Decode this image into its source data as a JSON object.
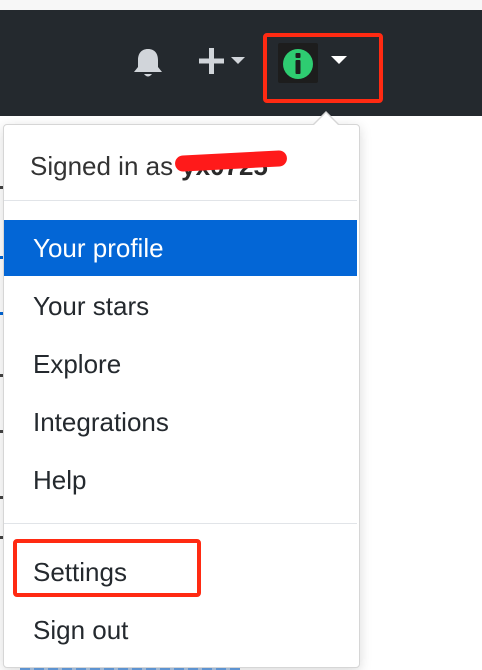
{
  "header": {
    "icons": {
      "notifications": "bell-icon",
      "create_new": "plus-icon",
      "create_caret": "caret-down-icon",
      "avatar": "avatar-identicon",
      "avatar_caret": "caret-down-icon"
    },
    "avatar_letter": "i",
    "colors": {
      "header_bg": "#24292e",
      "icon": "#d1d5da",
      "avatar_green": "#2ecc71"
    }
  },
  "dropdown": {
    "signed_in_prefix": "Signed in as",
    "username": "yx0725",
    "items": [
      {
        "label": "Your profile",
        "active": true
      },
      {
        "label": "Your stars"
      },
      {
        "label": "Explore"
      },
      {
        "label": "Integrations"
      },
      {
        "label": "Help"
      },
      {
        "label": "Settings"
      },
      {
        "label": "Sign out"
      }
    ]
  },
  "annotations": {
    "highlight_color": "#ff2a12",
    "redaction_color": "#ff1a1a"
  },
  "colors": {
    "active_item_bg": "#0366d6",
    "active_item_text": "#ffffff",
    "item_text": "#24292e"
  }
}
